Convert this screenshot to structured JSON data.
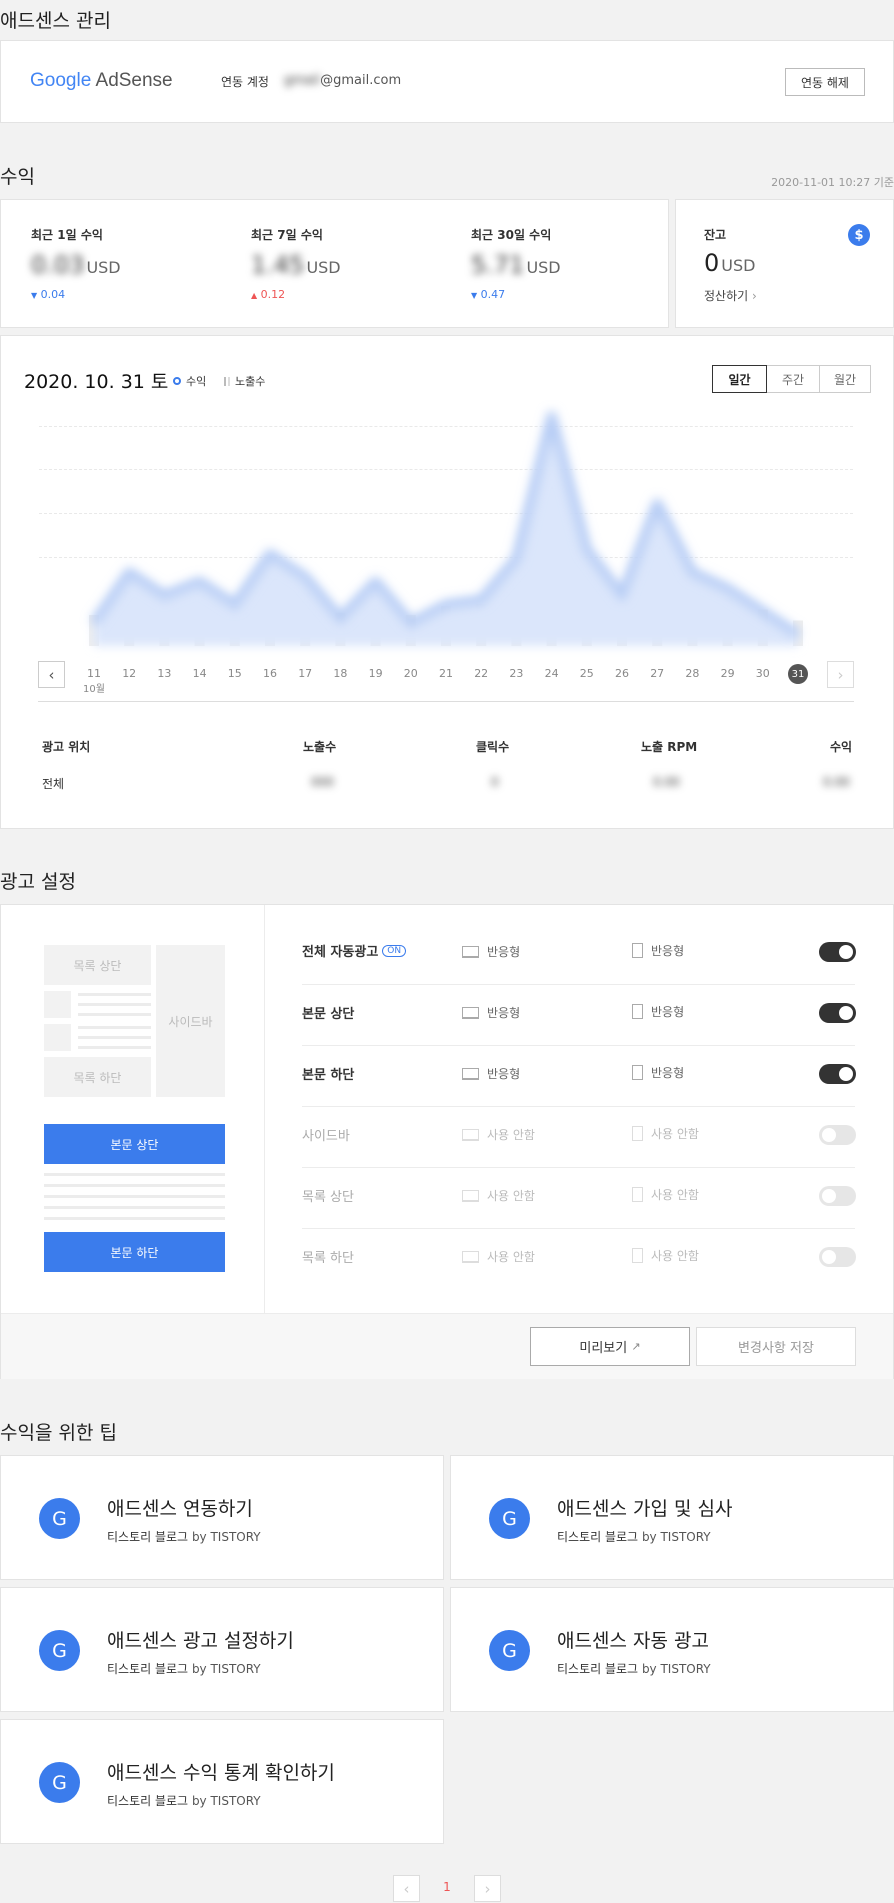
{
  "page_title": "애드센스 관리",
  "account": {
    "logo_google": "Google",
    "logo_adsense": "AdSense",
    "label": "연동 계정",
    "email_hidden": "gmail",
    "email_domain": "@gmail.com",
    "disconnect_button": "연동 해제"
  },
  "revenue": {
    "section_title": "수익",
    "timestamp": "2020-11-01 10:27 기준",
    "stats": [
      {
        "label": "최근 1일 수익",
        "value": "0.03",
        "unit": "USD",
        "delta": "0.04",
        "direction": "down"
      },
      {
        "label": "최근 7일 수익",
        "value": "1.45",
        "unit": "USD",
        "delta": "0.12",
        "direction": "up"
      },
      {
        "label": "최근 30일 수익",
        "value": "5.71",
        "unit": "USD",
        "delta": "0.47",
        "direction": "down"
      }
    ],
    "balance": {
      "label": "잔고",
      "value": "0",
      "unit": "USD",
      "link": "정산하기",
      "icon": "dollar-icon"
    }
  },
  "chart": {
    "date": "2020. 10. 31 토",
    "legend": [
      "수익",
      "노출수"
    ],
    "tabs": [
      "일간",
      "주간",
      "월간"
    ],
    "active_tab": 0,
    "month_label": "10월",
    "chart_data": {
      "type": "area",
      "x": [
        "11",
        "12",
        "13",
        "14",
        "15",
        "16",
        "17",
        "18",
        "19",
        "20",
        "21",
        "22",
        "23",
        "24",
        "25",
        "26",
        "27",
        "28",
        "29",
        "30",
        "31"
      ],
      "series": [
        {
          "name": "수익",
          "values": [
            0.1,
            0.32,
            0.22,
            0.28,
            0.18,
            0.4,
            0.3,
            0.12,
            0.28,
            0.1,
            0.18,
            0.2,
            0.38,
            1.0,
            0.42,
            0.22,
            0.62,
            0.32,
            0.25,
            0.15,
            0.05
          ]
        }
      ],
      "selected": "31"
    },
    "table": {
      "headers": [
        "광고 위치",
        "노출수",
        "클릭수",
        "노출 RPM",
        "수익"
      ],
      "rows": [
        [
          "전체",
          "000",
          "0",
          "0.00",
          "0.00"
        ]
      ]
    }
  },
  "ad_settings": {
    "section_title": "광고 설정",
    "layout_labels": {
      "list_top": "목록 상단",
      "list_bottom": "목록 하단",
      "sidebar": "사이드바",
      "body_top": "본문 상단",
      "body_bottom": "본문 하단"
    },
    "rows": [
      {
        "label": "전체 자동광고",
        "badge": "ON",
        "pc": "반응형",
        "mobile": "반응형",
        "enabled": true
      },
      {
        "label": "본문 상단",
        "badge": "",
        "pc": "반응형",
        "mobile": "반응형",
        "enabled": true
      },
      {
        "label": "본문 하단",
        "badge": "",
        "pc": "반응형",
        "mobile": "반응형",
        "enabled": true
      },
      {
        "label": "사이드바",
        "badge": "",
        "pc": "사용 안함",
        "mobile": "사용 안함",
        "enabled": false
      },
      {
        "label": "목록 상단",
        "badge": "",
        "pc": "사용 안함",
        "mobile": "사용 안함",
        "enabled": false
      },
      {
        "label": "목록 하단",
        "badge": "",
        "pc": "사용 안함",
        "mobile": "사용 안함",
        "enabled": false
      }
    ],
    "preview_button": "미리보기",
    "save_button": "변경사항 저장"
  },
  "tips": {
    "section_title": "수익을 위한 팁",
    "items": [
      {
        "icon_letter": "G",
        "title": "애드센스 연동하기",
        "source": "티스토리 블로그",
        "by": "by TISTORY"
      },
      {
        "icon_letter": "G",
        "title": "애드센스 가입 및 심사",
        "source": "티스토리 블로그",
        "by": "by TISTORY"
      },
      {
        "icon_letter": "G",
        "title": "애드센스 광고 설정하기",
        "source": "티스토리 블로그",
        "by": "by TISTORY"
      },
      {
        "icon_letter": "G",
        "title": "애드센스 자동 광고",
        "source": "티스토리 블로그",
        "by": "by TISTORY"
      },
      {
        "icon_letter": "G",
        "title": "애드센스 수익 통계 확인하기",
        "source": "티스토리 블로그",
        "by": "by TISTORY"
      }
    ]
  },
  "pagination": {
    "current": "1",
    "prev": "‹",
    "next": "›"
  },
  "colors": {
    "accent": "#3b7cec",
    "up": "#ee5555",
    "down": "#3b7cec"
  }
}
